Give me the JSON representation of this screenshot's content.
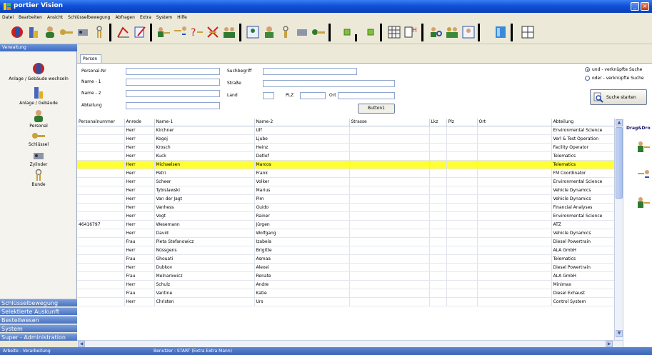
{
  "window": {
    "title": "portier Vision"
  },
  "menu": [
    "Datei",
    "Bearbeiten",
    "Ansicht",
    "Schlüsselbewegung",
    "Abfragen",
    "Extra",
    "System",
    "Hilfe"
  ],
  "nav": {
    "header": "Verwaltung",
    "items": [
      "Anlage / Gebäude wechseln",
      "Anlage / Gebäude",
      "Personal",
      "Schlüssel",
      "Zylinder",
      "Bunde"
    ],
    "groups": [
      "Schlüsselbewegung",
      "Selektierte Auskunft",
      "Bestellwesen",
      "System",
      "Super - Administration"
    ]
  },
  "tabs": [
    "Person"
  ],
  "form": {
    "labels": {
      "personal_nr": "Personal-Nr",
      "name1": "Name - 1",
      "name2": "Name - 2",
      "abteilung": "Abteilung",
      "suchbegriff": "Suchbegriff",
      "strasse": "Straße",
      "land": "Land",
      "plz": "PLZ",
      "ort": "Ort"
    },
    "button1": "Button1",
    "radio_and": "und - verknüpfte Suche",
    "radio_or": "oder - verknüpfte Suche",
    "search_button": "Suche starten"
  },
  "table": {
    "columns": [
      "Personalnummer",
      "Anrede",
      "Name-1",
      "Name-2",
      "Strasse",
      "Lkz",
      "Plz",
      "Ort",
      "Abteilung"
    ],
    "rows": [
      [
        "",
        "Herr",
        "Kirchner",
        "Ulf",
        "",
        "",
        "",
        "",
        "Environmental Science"
      ],
      [
        "",
        "Herr",
        "Kogoj",
        "Ljubo",
        "",
        "",
        "",
        "",
        "Verl & Test Operation"
      ],
      [
        "",
        "Herr",
        "Krosch",
        "Heinz",
        "",
        "",
        "",
        "",
        "Facility Operator"
      ],
      [
        "",
        "Herr",
        "Kuck",
        "Detlef",
        "",
        "",
        "",
        "",
        "Telematics"
      ],
      [
        "",
        "Herr",
        "Michaelsen",
        "Marcos",
        "",
        "",
        "",
        "",
        "Telematics"
      ],
      [
        "",
        "Herr",
        "Petri",
        "Frank",
        "",
        "",
        "",
        "",
        "FM Coordinator"
      ],
      [
        "",
        "Herr",
        "Scheer",
        "Volker",
        "",
        "",
        "",
        "",
        "Environmental Science"
      ],
      [
        "",
        "Herr",
        "Tybislawski",
        "Marius",
        "",
        "",
        "",
        "",
        "Vehicle Dynamics"
      ],
      [
        "",
        "Herr",
        "Van der Jagt",
        "Pim",
        "",
        "",
        "",
        "",
        "Vehicle Dynamics"
      ],
      [
        "",
        "Herr",
        "Vanhess",
        "Guido",
        "",
        "",
        "",
        "",
        "Financial Analyses"
      ],
      [
        "",
        "Herr",
        "Vogt",
        "Rainer",
        "",
        "",
        "",
        "",
        "Environmental Science"
      ],
      [
        "46416797",
        "Herr",
        "Wesemann",
        "Jürgen",
        "",
        "",
        "",
        "",
        "ATZ"
      ],
      [
        "",
        "Herr",
        "David",
        "Wolfgang",
        "",
        "",
        "",
        "",
        "Vehicle Dynamics"
      ],
      [
        "",
        "Frau",
        "Pieta Stefanowicz",
        "Izabela",
        "",
        "",
        "",
        "",
        "Diesel Powertrain"
      ],
      [
        "",
        "Herr",
        "Nüssgens",
        "Brigitte",
        "",
        "",
        "",
        "",
        "ALA GmbH"
      ],
      [
        "",
        "Frau",
        "Ghouati",
        "Asmaa",
        "",
        "",
        "",
        "",
        "Telematics"
      ],
      [
        "",
        "Herr",
        "Dubkov",
        "Alexei",
        "",
        "",
        "",
        "",
        "Diesel Powertrain"
      ],
      [
        "",
        "Frau",
        "Melnarowicz",
        "Renate",
        "",
        "",
        "",
        "",
        "ALA GmbH"
      ],
      [
        "",
        "Herr",
        "Schulz",
        "Andre",
        "",
        "",
        "",
        "",
        "Minimax"
      ],
      [
        "",
        "Frau",
        "Vantine",
        "Katie",
        "",
        "",
        "",
        "",
        "Diesel Exhaust"
      ],
      [
        "",
        "Herr",
        "Christen",
        "Urs",
        "",
        "",
        "",
        "",
        "Control System"
      ]
    ],
    "selected_row": 4
  },
  "dragdrop": {
    "title": "Drag&Dro"
  },
  "status": {
    "left": "Arbeite - Verarbeitung",
    "mid": "Benutzer : START  (Extra Extra Mann)"
  },
  "colors": {
    "selected_row": "#ffff33",
    "title_bar": "#1050d8",
    "nav_group": "#4a73c2"
  }
}
